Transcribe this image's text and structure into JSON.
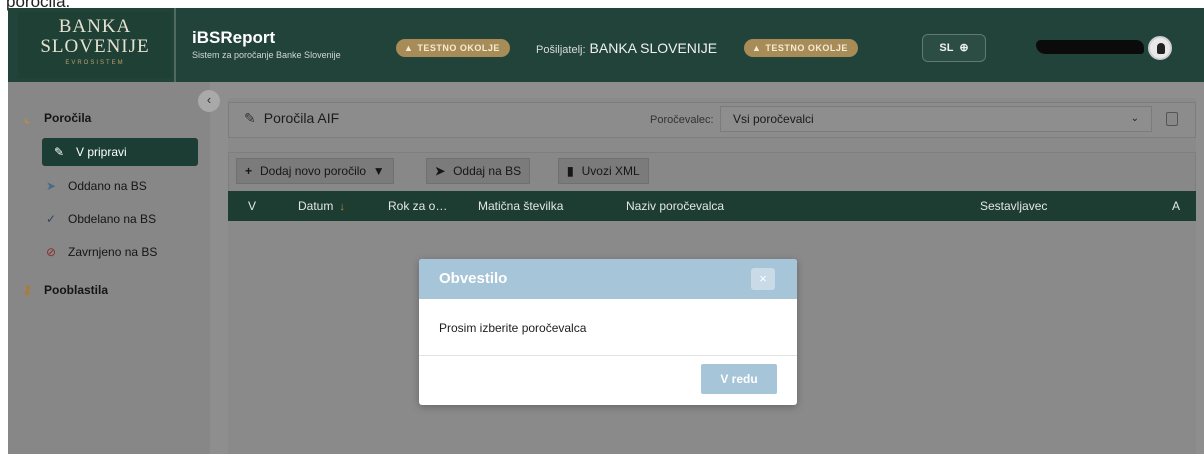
{
  "caption": "poročila.",
  "header": {
    "logo_line1": "BANKA",
    "logo_line2": "SLOVENIJE",
    "logo_line3": "EVROSISTEM",
    "app_title": "iBSReport",
    "app_subtitle": "Sistem za poročanje Banke Slovenije",
    "env_badge": "TESTNO OKOLJE",
    "sender_label": "Pošiljatelj:",
    "sender_value": "BANKA SLOVENIJE",
    "language": "SL",
    "colors": {
      "header_bg": "#22433a",
      "badge": "#a88c57",
      "accent_dark": "#1c3d33"
    }
  },
  "sidebar": {
    "collapse_icon": "chevron-left-icon",
    "sections": [
      {
        "label": "Poročila",
        "icon": "line-chart-icon",
        "items": [
          {
            "label": "V pripravi",
            "icon": "edit-icon",
            "active": true
          },
          {
            "label": "Oddano na BS",
            "icon": "send-icon"
          },
          {
            "label": "Obdelano na BS",
            "icon": "check-icon"
          },
          {
            "label": "Zavrnjeno na BS",
            "icon": "ban-icon"
          }
        ]
      },
      {
        "label": "Pooblastila",
        "icon": "key-icon",
        "items": []
      }
    ]
  },
  "main": {
    "page_title": "Poročila AIF",
    "reporter_label": "Poročevalec:",
    "reporter_value": "Vsi poročevalci",
    "toolbar": {
      "add_label": "Dodaj novo poročilo",
      "submit_label": "Oddaj na BS",
      "import_label": "Uvozi XML"
    },
    "table_columns": [
      "V",
      "Datum",
      "Rok za o…",
      "Matična številka",
      "Naziv poročevalca",
      "Sestavljavec",
      "A"
    ]
  },
  "modal": {
    "title": "Obvestilo",
    "message": "Prosim izberite poročevalca",
    "ok_label": "V redu",
    "close_symbol": "×"
  }
}
